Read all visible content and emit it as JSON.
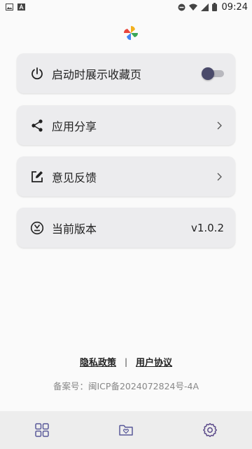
{
  "status_bar": {
    "time": "09:24",
    "left_icons": [
      "image-icon",
      "font-icon"
    ],
    "right_icons": [
      "do-not-disturb-icon",
      "wifi-icon",
      "signal-icon",
      "battery-icon"
    ]
  },
  "colors": {
    "card_bg": "#ececee",
    "toggle_thumb": "#4a4a6a",
    "toggle_track": "#b8b8be",
    "nav_active": "#5b4a8a",
    "nav_inactive": "#5a5a9a"
  },
  "settings": {
    "startup_favorites": {
      "label": "启动时展示收藏页",
      "icon": "power-icon",
      "enabled": false
    },
    "share": {
      "label": "应用分享",
      "icon": "share-icon"
    },
    "feedback": {
      "label": "意见反馈",
      "icon": "edit-icon"
    },
    "version": {
      "label": "当前版本",
      "icon": "version-icon",
      "value": "v1.0.2"
    }
  },
  "footer": {
    "privacy_label": "隐私政策",
    "separator": "|",
    "agreement_label": "用户协议",
    "icp": "备案号：闽ICP备2024072824号-4A"
  },
  "bottom_nav": {
    "items": [
      {
        "icon": "grid-icon",
        "active": false
      },
      {
        "icon": "folder-heart-icon",
        "active": false
      },
      {
        "icon": "settings-icon",
        "active": true
      }
    ]
  }
}
